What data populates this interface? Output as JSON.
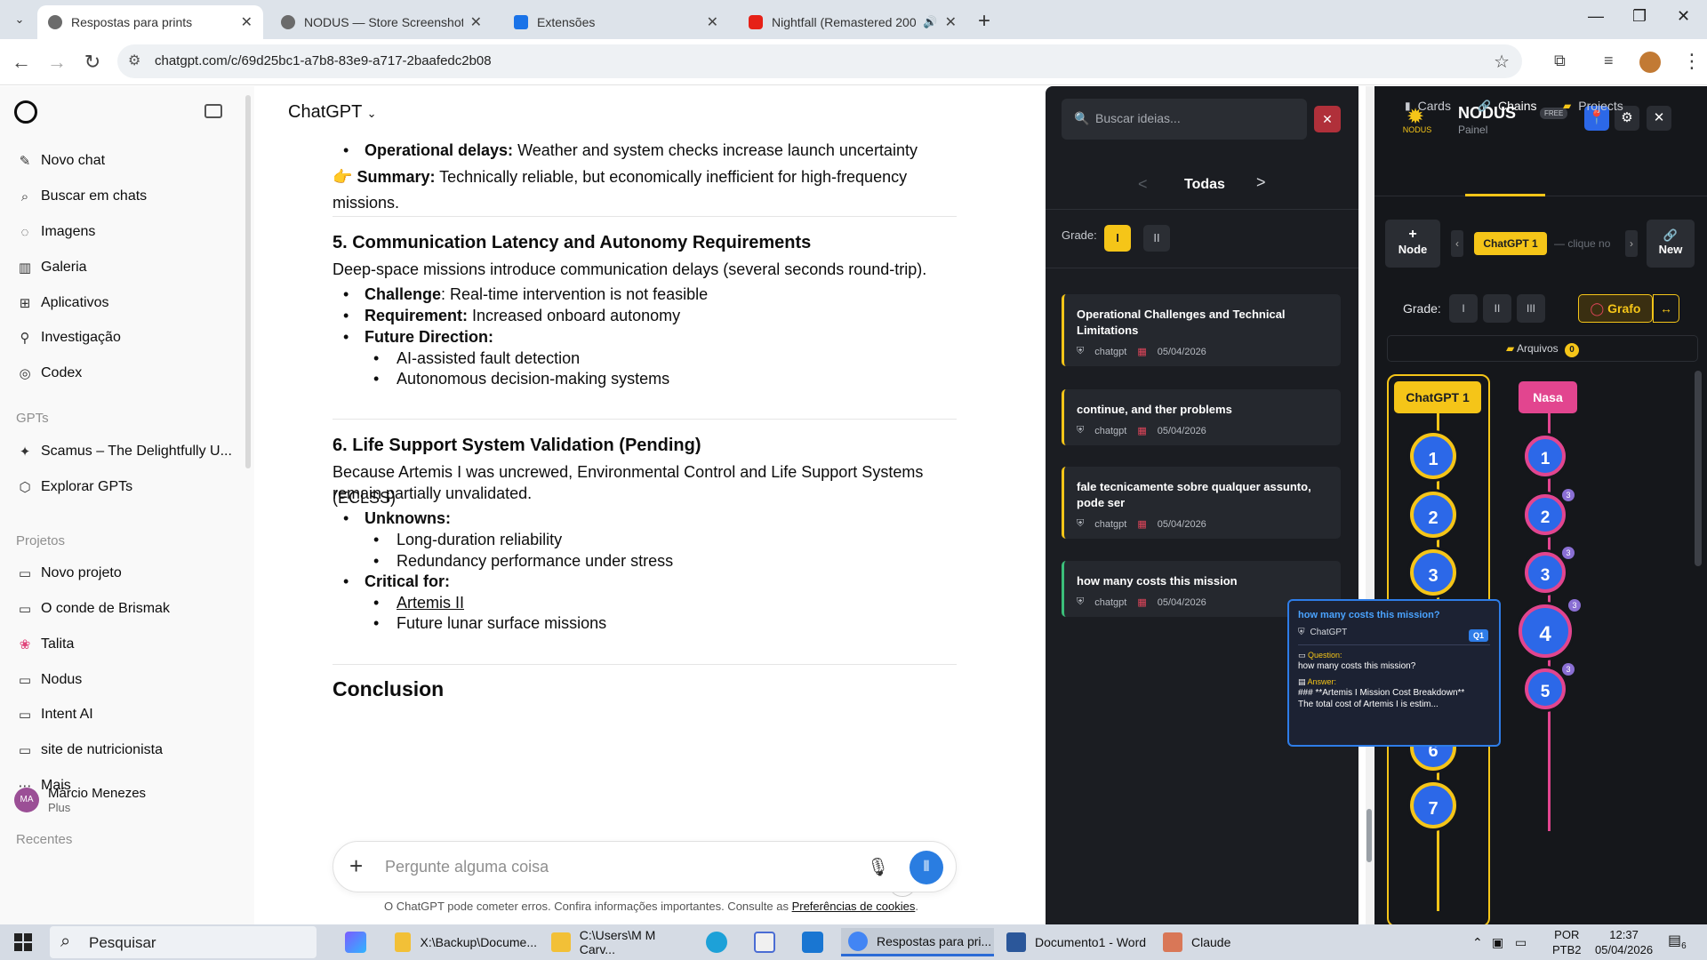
{
  "browser": {
    "tabs": [
      {
        "title": "Respostas para prints",
        "active": true,
        "favicon_color": "#6b6b6b"
      },
      {
        "title": "NODUS — Store Screenshot Re",
        "active": false,
        "favicon_color": "#6b6b6b"
      },
      {
        "title": "Extensões",
        "active": false,
        "favicon_color": "#1a73e8"
      },
      {
        "title": "Nightfall (Remastered 2007",
        "active": false,
        "favicon_color": "#e62117"
      }
    ],
    "url": "chatgpt.com/c/69d25bc1-a7b8-83e9-a717-2baafedc2b08"
  },
  "sidebar": {
    "items": [
      {
        "icon": "new-chat-icon",
        "label": "Novo chat"
      },
      {
        "icon": "search-icon",
        "label": "Buscar em chats"
      },
      {
        "icon": "image-icon",
        "label": "Imagens"
      },
      {
        "icon": "gallery-icon",
        "label": "Galeria"
      },
      {
        "icon": "apps-icon",
        "label": "Aplicativos"
      },
      {
        "icon": "research-icon",
        "label": "Investigação"
      },
      {
        "icon": "codex-icon",
        "label": "Codex"
      }
    ],
    "gpts_header": "GPTs",
    "gpts": [
      {
        "icon": "gpt-icon",
        "label": "Scamus – The Delightfully U..."
      },
      {
        "icon": "explore-icon",
        "label": "Explorar GPTs"
      }
    ],
    "projects_header": "Projetos",
    "projects": [
      {
        "icon": "folder-icon",
        "label": "Novo projeto"
      },
      {
        "icon": "folder-icon",
        "label": "O conde de Brismak"
      },
      {
        "icon": "paw-icon",
        "label": "Talita"
      },
      {
        "icon": "folder-icon",
        "label": "Nodus"
      },
      {
        "icon": "folder-icon",
        "label": "Intent AI"
      },
      {
        "icon": "folder-icon",
        "label": "site de nutricionista"
      },
      {
        "icon": "more-icon",
        "label": "Mais"
      }
    ],
    "recent_header": "Recentes",
    "user": {
      "initials": "MA",
      "name": "Márcio Menezes",
      "plan": "Plus"
    }
  },
  "chat": {
    "title": "ChatGPT",
    "lines": {
      "op_delays_b": "Operational delays:",
      "op_delays": " Weather and system checks increase launch uncertainty",
      "summary_b": "Summary:",
      "summary": " Technically reliable, but economically inefficient for high-frequency missions.",
      "h5": "5. Communication Latency and Autonomy Requirements",
      "p5": "Deep-space missions introduce communication delays (several seconds round-trip).",
      "challenge_b": "Challenge",
      "challenge": ": Real-time intervention is not feasible",
      "requirement_b": "Requirement:",
      "requirement": " Increased onboard autonomy",
      "future_b": "Future Direction:",
      "future_1": "AI-assisted fault detection",
      "future_2": "Autonomous decision-making systems",
      "h6": "6. Life Support System Validation (Pending)",
      "p6a": "Because Artemis I was uncrewed, Environmental Control and Life Support Systems (ECLSS)",
      "p6b": "remain partially unvalidated.",
      "unknowns_b": "Unknowns:",
      "unknowns_1": "Long-duration reliability",
      "unknowns_2": "Redundancy performance under stress",
      "critical_b": "Critical for:",
      "critical_1": "Artemis II",
      "critical_2": "Future lunar surface missions",
      "conclusion": "Conclusion"
    },
    "composer_placeholder": "Pergunte alguma coisa",
    "disclaimer": "O ChatGPT pode cometer erros. Confira informações importantes. Consulte as ",
    "disclaimer_link": "Preferências de cookies",
    "disclaimer_end": "."
  },
  "ideas": {
    "search_placeholder": "Buscar ideias...",
    "filter_title": "Todas",
    "grade_label": "Grade:",
    "grade_options": [
      "I",
      "II"
    ],
    "cards": [
      {
        "title": "Operational Challenges and Technical Limitations",
        "source": "chatgpt",
        "date": "05/04/2026",
        "accent": "#f5c518"
      },
      {
        "title": "continue, and ther problems",
        "source": "chatgpt",
        "date": "05/04/2026",
        "accent": "#f5c518"
      },
      {
        "title": "fale tecnicamente sobre qualquer assunto, pode ser",
        "source": "chatgpt",
        "date": "05/04/2026",
        "accent": "#f5c518"
      },
      {
        "title": "how many costs this mission",
        "source": "chatgpt",
        "date": "05/04/2026",
        "accent": "#3bbf7a"
      }
    ]
  },
  "nodus": {
    "logo_label": "NODUS",
    "title": "NODUS",
    "badge": "FREE",
    "subtitle": "Painel",
    "tabs": [
      "Cards",
      "Chains",
      "Projects"
    ],
    "active_tab": "Chains",
    "node_label": "Node",
    "chain_chip": "ChatGPT 1",
    "chain_hint": "— clique no",
    "new_label": "New",
    "grade_label": "Grade:",
    "grade_options": [
      "I",
      "II",
      "III"
    ],
    "grafo_label": "Grafo",
    "arrow_label": "↔",
    "files_label": "Arquivos",
    "files_count": "0",
    "lanes": [
      {
        "label": "ChatGPT 1",
        "color": "#f5c518",
        "nodes": [
          "1",
          "2",
          "3",
          "4",
          "5",
          "6",
          "7"
        ]
      },
      {
        "label": "Nasa",
        "color": "#e2458f",
        "nodes": [
          "1",
          "2",
          "3",
          "4",
          "5"
        ],
        "badge": "3"
      }
    ]
  },
  "tooltip": {
    "title": "how many costs this mission?",
    "source": "ChatGPT",
    "tag": "Q1",
    "question_label": "Question:",
    "question": "how many costs this mission?",
    "answer_label": "Answer:",
    "answer_1": "### **Artemis I Mission Cost Breakdown**",
    "answer_2": "The total cost of Artemis I is estim..."
  },
  "taskbar": {
    "search_placeholder": "Pesquisar",
    "apps": [
      {
        "label": "X:\\Backup\\Docume...",
        "color": "#f2c037"
      },
      {
        "label": "C:\\Users\\M M Carv...",
        "color": "#f2c037"
      },
      {
        "label": "Respostas para pri...",
        "color": "#4285f4",
        "active": true
      },
      {
        "label": "Documento1 - Word",
        "color": "#2b579a"
      },
      {
        "label": "Claude",
        "color": "#d97757"
      }
    ],
    "lang_1": "POR",
    "lang_2": "PTB2",
    "time": "12:37",
    "date": "05/04/2026",
    "notifications": "6"
  }
}
